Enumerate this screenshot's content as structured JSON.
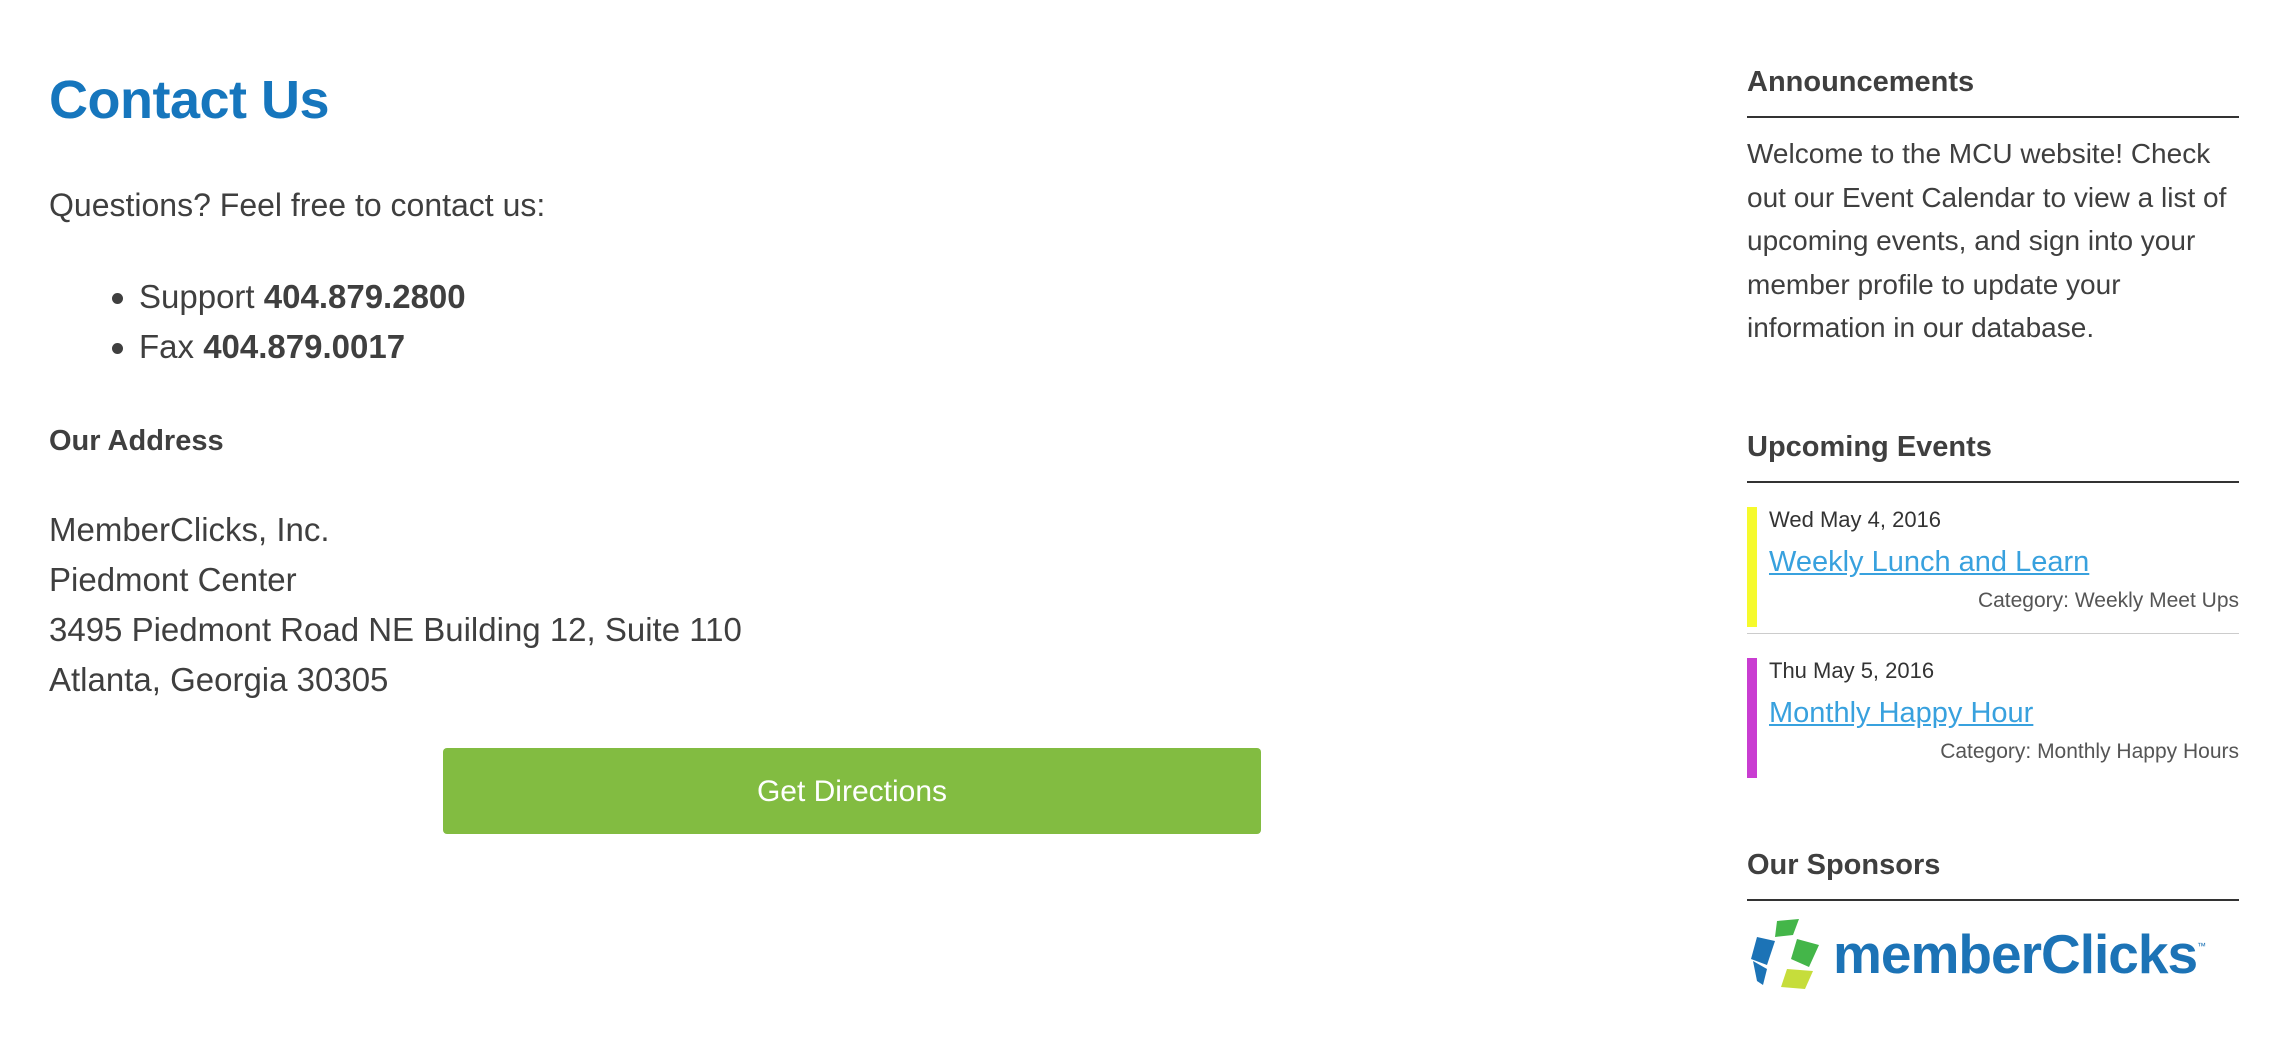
{
  "main": {
    "title": "Contact Us",
    "intro": "Questions? Feel free to contact us:",
    "phones": [
      {
        "label": "Support",
        "number": "404.879.2800"
      },
      {
        "label": "Fax",
        "number": "404.879.0017"
      }
    ],
    "address_heading": "Our Address",
    "address_lines": [
      "MemberClicks, Inc.",
      "Piedmont Center",
      "3495 Piedmont Road NE Building 12, Suite 110",
      "Atlanta, Georgia 30305"
    ],
    "directions_button": "Get Directions"
  },
  "sidebar": {
    "announcements": {
      "title": "Announcements",
      "text": "Welcome to the MCU website! Check out our Event Calendar to view a list of upcoming events, and sign into your member profile to update your information in our database."
    },
    "events": {
      "title": "Upcoming Events",
      "items": [
        {
          "date": "Wed May 4, 2016",
          "title": "Weekly Lunch and Learn",
          "category": "Category: Weekly Meet Ups",
          "color": "#f6fa2c"
        },
        {
          "date": "Thu May 5, 2016",
          "title": "Monthly Happy Hour",
          "category": "Category: Monthly Happy Hours",
          "color": "#c93dd1"
        }
      ]
    },
    "sponsors": {
      "title": "Our Sponsors",
      "logo_text": "memberClicks",
      "logo_tm": "™"
    }
  },
  "colors": {
    "title_blue": "#1676bd",
    "link_blue": "#38a1de",
    "button_green": "#82bc41",
    "text": "#3f3f3f"
  }
}
